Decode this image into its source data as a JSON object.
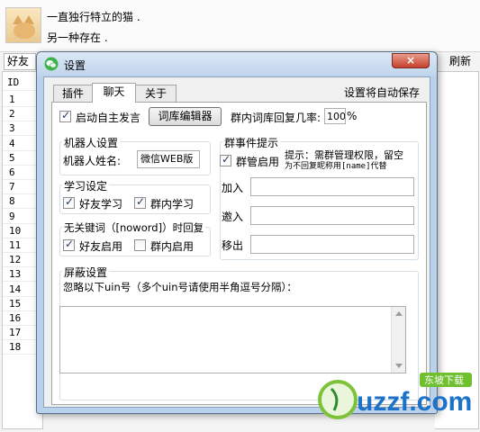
{
  "background": {
    "status_line_1": "一直独行特立的猫 .",
    "status_line_2": "另一种存在 .",
    "friends_tab": "好友",
    "refresh_label": "刷新",
    "id_header": "ID",
    "row_ids": [
      "1",
      "2",
      "3",
      "4",
      "5",
      "6",
      "7",
      "8",
      "9",
      "10",
      "11",
      "12",
      "13",
      "14",
      "15",
      "16",
      "17",
      "18"
    ]
  },
  "dialog": {
    "title": "设置",
    "icon": "chat-bubble-icon",
    "close_icon": "close-icon",
    "close_label": "×",
    "tabs": [
      {
        "label": "插件",
        "active": false
      },
      {
        "label": "聊天",
        "active": true
      },
      {
        "label": "关于",
        "active": false
      }
    ],
    "autosave_note": "设置将自动保存",
    "auto_speak": {
      "label": "启动自主发言",
      "checked": true
    },
    "lexicon_button": "词库编辑器",
    "group_reply_rate_label": "群内词库回复几率:",
    "group_reply_rate_value": "100",
    "group_reply_rate_unit": "%",
    "robot_settings": {
      "title": "机器人设置",
      "name_label": "机器人姓名:",
      "name_value": "微信WEB版"
    },
    "learning": {
      "title": "学习设定",
      "friend_learning": {
        "label": "好友学习",
        "checked": true
      },
      "group_learning": {
        "label": "群内学习",
        "checked": true
      }
    },
    "noword": {
      "title": "无关键词（[noword]）时回复",
      "friend_enable": {
        "label": "好友启用",
        "checked": true
      },
      "group_enable": {
        "label": "群内启用",
        "checked": false
      }
    },
    "group_events": {
      "title": "群事件提示",
      "admin_enable": {
        "label": "群管启用",
        "checked": true
      },
      "hint_line_1": "提示：需群管理权限，留空",
      "hint_line_2": "为不回复昵称用[name]代替",
      "join_label": "加入",
      "join_value": "",
      "invite_label": "邀入",
      "invite_value": "",
      "remove_label": "移出",
      "remove_value": ""
    },
    "block": {
      "title": "屏蔽设置",
      "description": "忽略以下uin号（多个uin号请使用半角逗号分隔）：",
      "value": ""
    }
  },
  "watermark": {
    "text": "uzzf.com",
    "subtitle": "东坡下载",
    "colors": {
      "green": "#7ec23a",
      "blue": "#1b72c8"
    }
  }
}
